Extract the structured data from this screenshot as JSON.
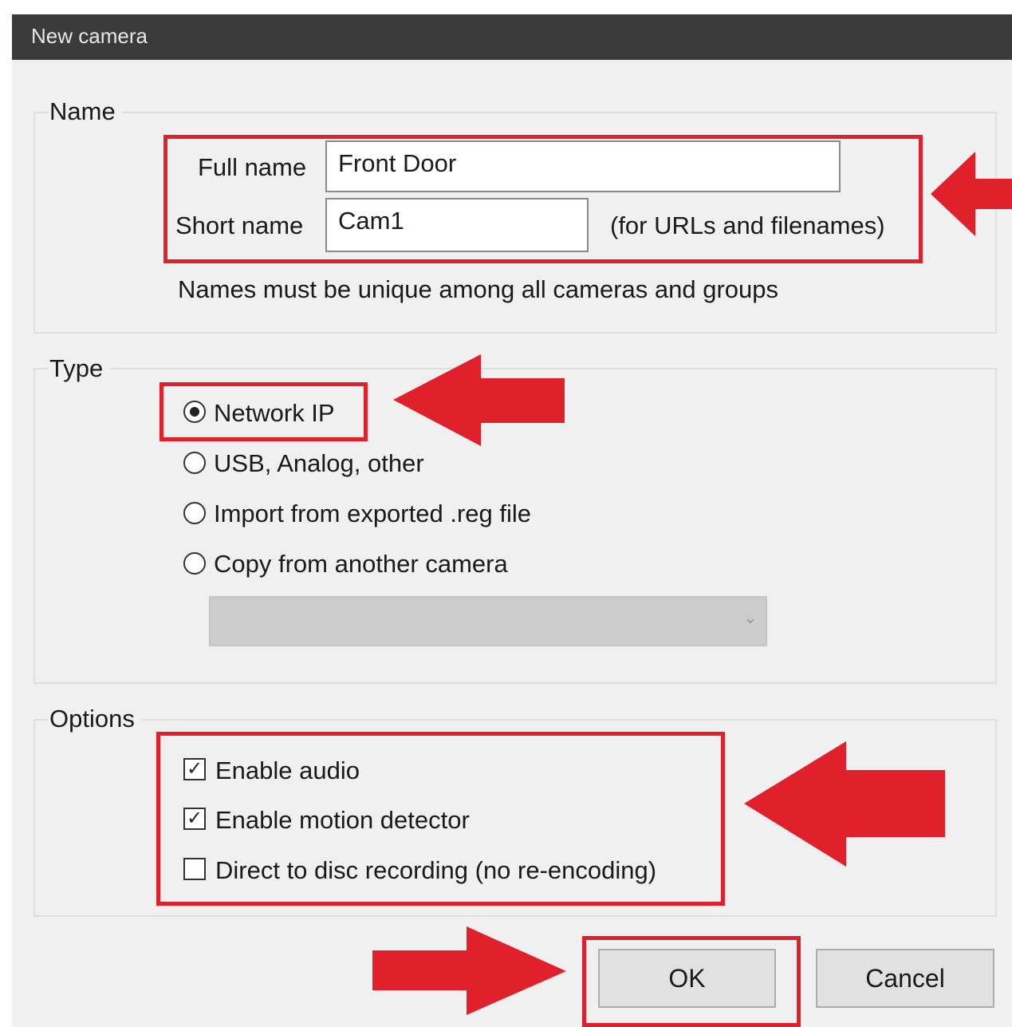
{
  "window": {
    "title": "New camera"
  },
  "name_group": {
    "title": "Name",
    "full_name_label": "Full name",
    "full_name_value": "Front Door",
    "short_name_label": "Short name",
    "short_name_value": "Cam1",
    "short_name_hint": "(for URLs and filenames)",
    "uniqueness_note": "Names must be unique among all cameras and groups"
  },
  "type_group": {
    "title": "Type",
    "options": [
      {
        "label": "Network IP",
        "selected": true
      },
      {
        "label": "USB, Analog, other",
        "selected": false
      },
      {
        "label": "Import from exported .reg file",
        "selected": false
      },
      {
        "label": "Copy from another camera",
        "selected": false
      }
    ],
    "camera_dropdown_value": "",
    "camera_dropdown_enabled": false
  },
  "options_group": {
    "title": "Options",
    "checkboxes": [
      {
        "label": "Enable audio",
        "checked": true
      },
      {
        "label": "Enable motion detector",
        "checked": true
      },
      {
        "label": "Direct to disc recording (no re-encoding)",
        "checked": false
      }
    ]
  },
  "buttons": {
    "ok": "OK",
    "cancel": "Cancel"
  },
  "annotation": {
    "highlight_color": "#e0202a"
  },
  "icons": {
    "radio_selected": "radio-filled-icon",
    "radio_empty": "radio-empty-icon",
    "checkbox_checked": "checkbox-checked-icon",
    "checkbox_empty": "checkbox-empty-icon",
    "dropdown": "chevron-down-icon",
    "annotation_arrow": "red-arrow-icon"
  }
}
